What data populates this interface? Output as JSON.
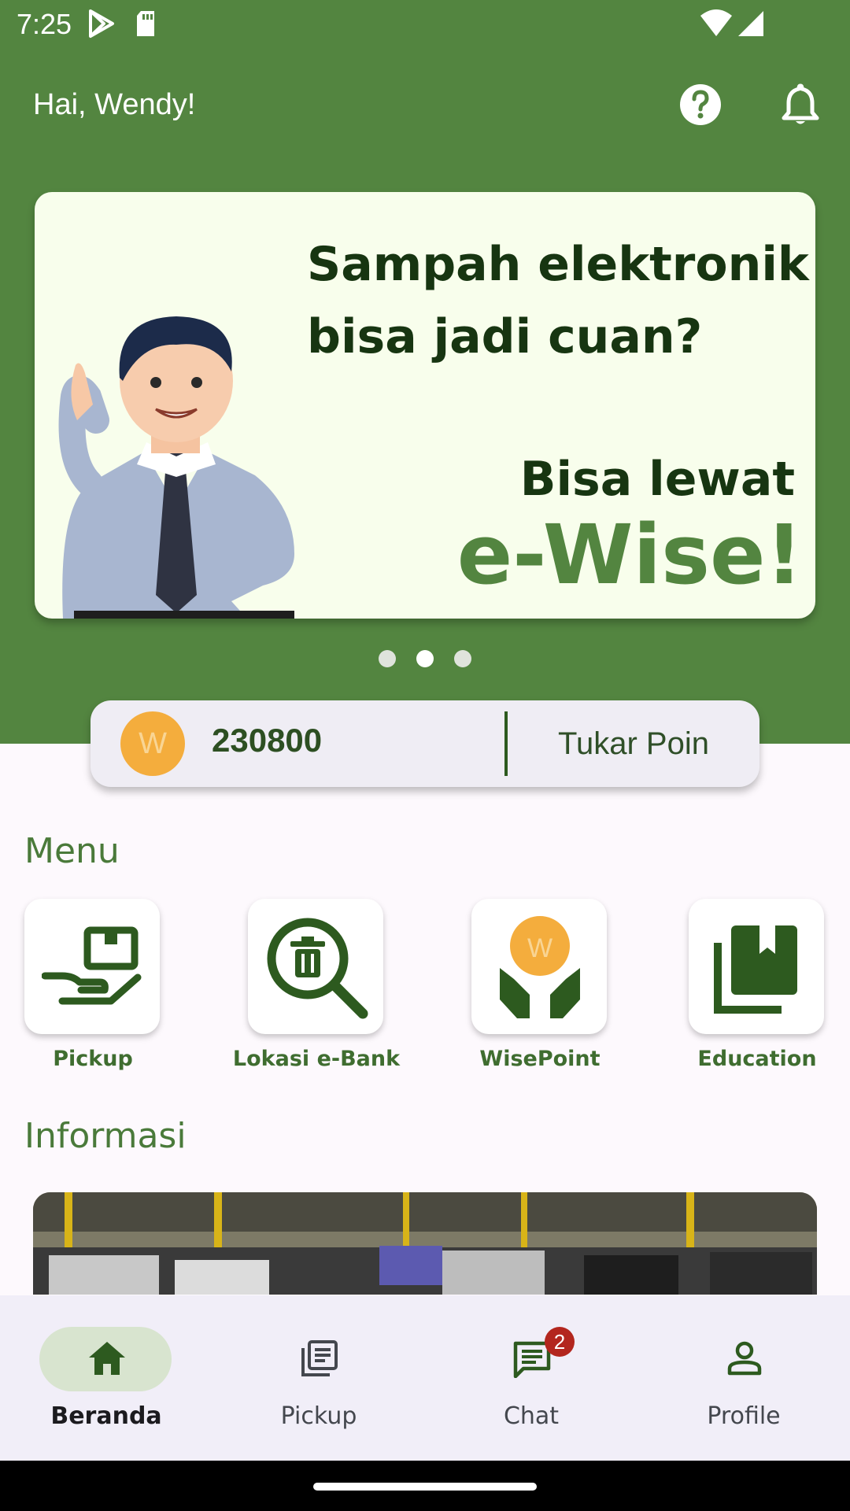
{
  "status_bar": {
    "time": "7:25"
  },
  "header": {
    "greeting": "Hai, Wendy!",
    "help_icon": "help-circle-icon",
    "notification_icon": "bell-icon"
  },
  "banner": {
    "headline": "Sampah elektronik bisa jadi cuan?",
    "tagline": "Bisa lewat",
    "brand": "e-Wise!",
    "carousel_total": 3,
    "carousel_active_index": 2
  },
  "points": {
    "coin_letter": "W",
    "value": "230800",
    "redeem_label": "Tukar Poin"
  },
  "menu": {
    "title": "Menu",
    "items": [
      {
        "label": "Pickup",
        "icon": "hand-package-icon"
      },
      {
        "label": "Lokasi e-Bank",
        "icon": "search-trash-icon"
      },
      {
        "label": "WisePoint",
        "icon": "hands-coin-icon"
      },
      {
        "label": "Education",
        "icon": "book-icon"
      }
    ]
  },
  "info": {
    "title": "Informasi"
  },
  "bottom_nav": {
    "items": [
      {
        "label": "Beranda",
        "icon": "home-icon",
        "active": true
      },
      {
        "label": "Pickup",
        "icon": "article-icon"
      },
      {
        "label": "Chat",
        "icon": "chat-icon",
        "badge": "2"
      },
      {
        "label": "Profile",
        "icon": "person-icon"
      }
    ]
  },
  "colors": {
    "primary_green": "#538540",
    "dark_green": "#2d5a1f",
    "coin": "#f4ad3d",
    "badge": "#b3261e"
  }
}
